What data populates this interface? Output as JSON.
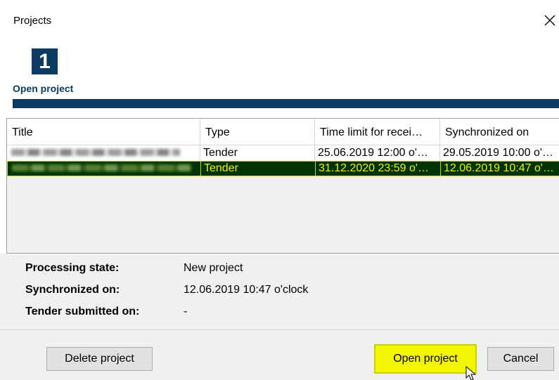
{
  "window": {
    "title": "Projects"
  },
  "wizard": {
    "step_number": "1",
    "step_label": "Open project"
  },
  "grid": {
    "columns": [
      "Title",
      "Type",
      "Time limit for recei…",
      "Synchronized on"
    ],
    "rows": [
      {
        "type": "Tender",
        "time_limit": "25.06.2019 12:00 o'…",
        "synchronized": "29.05.2019 10:00 o'…"
      },
      {
        "type": "Tender",
        "time_limit": "31.12.2020 23:59 o'…",
        "synchronized": "12.06.2019 10:47 o'…"
      }
    ]
  },
  "info": {
    "processing_state_label": "Processing state:",
    "processing_state_value": "New project",
    "synchronized_on_label": "Synchronized on:",
    "synchronized_on_value": "12.06.2019 10:47 o'clock",
    "tender_submitted_label": "Tender submitted on:",
    "tender_submitted_value": "-"
  },
  "buttons": {
    "delete": "Delete project",
    "open": "Open project",
    "cancel": "Cancel"
  },
  "colors": {
    "brand": "#0b3a63",
    "selection_bg": "#003300",
    "selection_text": "#f1f100",
    "highlight": "#f2f600"
  },
  "icons": {
    "close": "close-icon",
    "cursor": "mouse-pointer-icon"
  }
}
